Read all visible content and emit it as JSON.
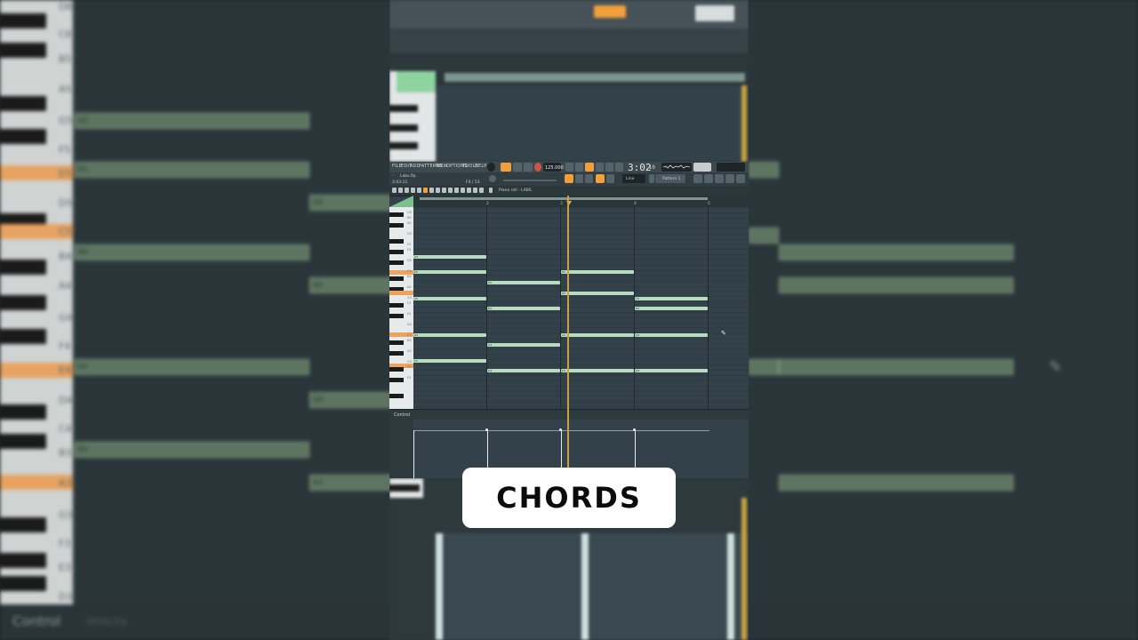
{
  "background": {
    "key_labels": [
      "D6",
      "C6",
      "B5",
      "A5",
      "G5",
      "F5",
      "E5",
      "D5",
      "C5",
      "B4",
      "A4",
      "G4",
      "F4",
      "E4",
      "D4",
      "C4",
      "B3",
      "A3",
      "G3",
      "F3",
      "E3",
      "D3"
    ],
    "note_labels": [
      "G5",
      "E5",
      "D5",
      "B4",
      "A4",
      "E4",
      "D4",
      "B3",
      "A3"
    ],
    "control_label": "Control",
    "control_sub": "Velocity"
  },
  "app": {
    "menu": [
      "FILE",
      "EDIT",
      "ADD",
      "PATTERNS",
      "VIEW",
      "OPTIONS",
      "TOOLS",
      "HELP"
    ],
    "tempo": "125.000",
    "time": "3:02",
    "time_sub": ":10",
    "snap": "Line",
    "pattern": "Pattern 1",
    "hint_name": "Labs.flp",
    "hint_pos": "F4 / 53",
    "hint_time": "3:03:11",
    "window_title": "Piano roll - LABS",
    "control_label": "Control",
    "bars": [
      "2",
      "3",
      "4",
      "5"
    ]
  },
  "keys": [
    "C6",
    "B5",
    "A5",
    "G5",
    "F5",
    "E5",
    "D5",
    "C5",
    "B4",
    "A4",
    "G4",
    "F4",
    "E4",
    "D4",
    "C4",
    "B3",
    "A3",
    "G3",
    "F3",
    "E3"
  ],
  "notes": {
    "chord1": [
      "G5",
      "E5",
      "C5",
      "A4",
      "F4"
    ],
    "chord2": [
      "D5",
      "B4",
      "G4",
      "D4"
    ],
    "chord3": [
      "E5",
      "D5",
      "A4",
      "D4"
    ],
    "chord4": [
      "C5",
      "B4",
      "A4",
      "D4"
    ]
  },
  "accent": "#f2a03a",
  "note_color": "#b7dcc0",
  "caption": "CHORDS"
}
